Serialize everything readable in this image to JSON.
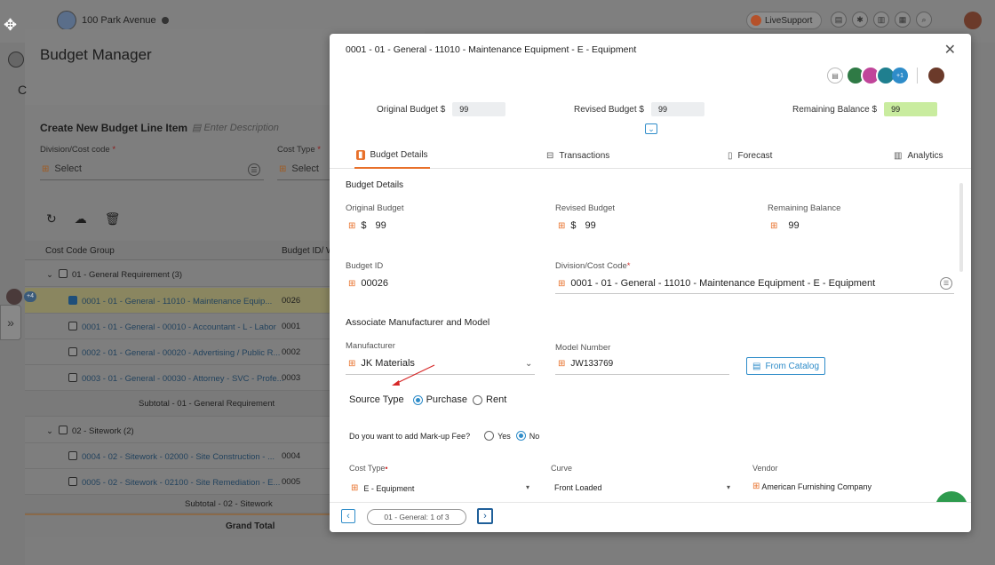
{
  "topbar": {
    "project_name": "100 Park Avenue",
    "live_support": "LiveSupport"
  },
  "budget_manager": {
    "title": "Budget Manager",
    "create": {
      "title": "Create New Budget Line Item",
      "description_placeholder": "Enter Description"
    },
    "division_label": "Division/Cost code",
    "division_value": "Select",
    "cost_type_label": "Cost Type",
    "cost_type_value": "Select",
    "table": {
      "col_group": "Cost Code Group",
      "col_budget_id": "Budget ID/ W",
      "groups": [
        {
          "label": "01 - General Requirement (3)"
        },
        {
          "label": "02 - Sitework (2)"
        }
      ],
      "rows": [
        {
          "label": "0001 - 01 - General - 11010 - Maintenance Equip...",
          "id": "0026"
        },
        {
          "label": "0001 - 01 - General - 00010 - Accountant - L - Labor",
          "id": "0001"
        },
        {
          "label": "0002 - 01 - General - 00020 - Advertising / Public R...",
          "id": "0002"
        },
        {
          "label": "0003 - 01 - General - 00030 - Attorney - SVC - Profe...",
          "id": "0003"
        },
        {
          "label": "0004 - 02 - Sitework - 02000 - Site Construction - ...",
          "id": "0004"
        },
        {
          "label": "0005 - 02 - Sitework - 02100 - Site Remediation - E...",
          "id": "0005"
        }
      ],
      "subtotal_1": "Subtotal - 01 - General Requirement",
      "subtotal_2": "Subtotal - 02 - Sitework",
      "grand_total": "Grand Total",
      "avatar_plus": "+4"
    }
  },
  "modal": {
    "title": "0001 - 01 - General - 11010 - Maintenance Equipment - E - Equipment",
    "avatar_plus": "+1",
    "kpis": {
      "original_label": "Original Budget $",
      "original_value": "99",
      "revised_label": "Revised Budget $",
      "revised_value": "99",
      "remaining_label": "Remaining Balance $",
      "remaining_value": "99"
    },
    "tabs": [
      "Budget Details",
      "Transactions",
      "Forecast",
      "Analytics"
    ],
    "details": {
      "section_title": "Budget Details",
      "original_label": "Original Budget",
      "original_currency": "$",
      "original_value": "99",
      "revised_label": "Revised Budget",
      "revised_currency": "$",
      "revised_value": "99",
      "remaining_label": "Remaining Balance",
      "remaining_value": "99",
      "budget_id_label": "Budget ID",
      "budget_id_value": "00026",
      "division_label": "Division/Cost Code",
      "division_value": "0001 - 01 - General - 11010 - Maintenance Equipment - E - Equipment",
      "assoc_title": "Associate Manufacturer and Model",
      "manufacturer_label": "Manufacturer",
      "manufacturer_value": "JK Materials",
      "model_label": "Model Number",
      "model_value": "JW133769",
      "catalog_button": "From Catalog",
      "source_type_label": "Source Type",
      "source_purchase": "Purchase",
      "source_rent": "Rent",
      "markup_question": "Do you want to add Mark-up Fee?",
      "markup_yes": "Yes",
      "markup_no": "No",
      "cost_type_label": "Cost Type",
      "cost_type_value": "E - Equipment",
      "curve_label": "Curve",
      "curve_value": "Front Loaded",
      "vendor_label": "Vendor",
      "vendor_value": "American Furnishing Company"
    },
    "pagination": {
      "label": "01 - General: 1 of 3"
    }
  }
}
